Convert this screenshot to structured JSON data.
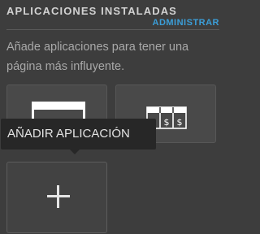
{
  "header": {
    "title": "APLICACIONES INSTALADAS",
    "manage_link": "ADMINISTRAR"
  },
  "description": "Añade aplicaciones para tener una página más influyente.",
  "apps": [
    {
      "icon": "window-icon"
    },
    {
      "icon": "pricing-table-icon",
      "cells": [
        "$",
        "$",
        "$"
      ]
    }
  ],
  "add_tile": {
    "icon": "plus-icon"
  },
  "tooltip": {
    "label": "AÑADIR APLICACIÓN"
  },
  "colors": {
    "background": "#3d3d3d",
    "accent": "#3b9ed8",
    "tile": "#494949",
    "tooltip": "#272727"
  }
}
